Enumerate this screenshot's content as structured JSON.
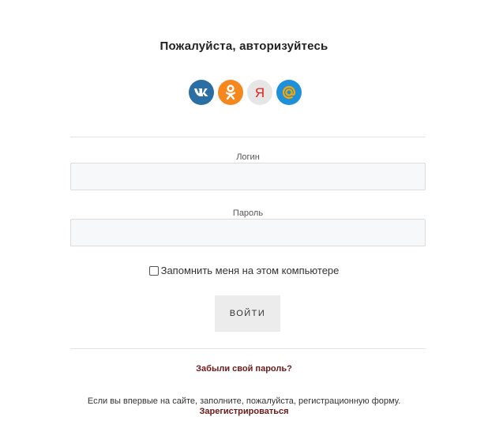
{
  "page": {
    "title": "Пожалуйста, авторизуйтесь"
  },
  "social": [
    {
      "name": "vk-icon",
      "label": "VK",
      "color": "#2a6ea3"
    },
    {
      "name": "odnoklassniki-icon",
      "label": "OK",
      "color": "#f4881f"
    },
    {
      "name": "yandex-icon",
      "label": "Я",
      "color": "#e6e6e6"
    },
    {
      "name": "mailru-icon",
      "label": "@",
      "color": "#1e8fd9"
    }
  ],
  "form": {
    "login_label": "Логин",
    "login_value": "",
    "password_label": "Пароль",
    "password_value": "",
    "remember_label": "Запомнить меня на этом компьютере",
    "remember_checked": false,
    "submit_label": "ВОЙТИ"
  },
  "footer": {
    "forgot_link": "Забыли свой пароль?",
    "register_hint": "Если вы впервые на сайте, заполните, пожалуйста, регистрационную форму.",
    "register_link": "Зарегистрироваться"
  },
  "colors": {
    "link": "#6b1a1a",
    "input_bg": "#f7f8fa",
    "button_bg": "#ececec"
  }
}
